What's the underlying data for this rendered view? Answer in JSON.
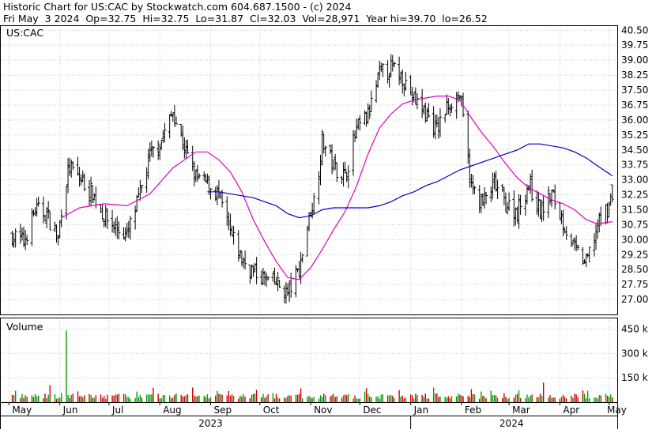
{
  "header": {
    "line1": "Historic Chart for US:CAC by Stockwatch.com 604.687.1500 - (c) 2024",
    "line2": "Fri May  3 2024  Op=32.75  Hi=32.75  Lo=31.87  Cl=32.03  Vol=28,971  Year hi=39.70  lo=26.52"
  },
  "colors": {
    "up_bar": "#00a000",
    "down_bar": "#d40000",
    "ohlc": "#000000",
    "short_ma": "#e000c0",
    "long_ma": "#0000c0",
    "grid": "#c8c8c8"
  },
  "chart_data": [
    {
      "type": "line",
      "subtype": "ohlc-price",
      "title": "US:CAC",
      "x_type": "date",
      "x_range": [
        "2023-05-03",
        "2024-05-03"
      ],
      "ylim": [
        26.25,
        40.75
      ],
      "grid": true,
      "y_ticks": [
        "40.50",
        "39.75",
        "39.00",
        "38.25",
        "37.50",
        "36.75",
        "36.00",
        "35.25",
        "34.50",
        "33.75",
        "33.00",
        "32.25",
        "31.50",
        "30.75",
        "30.00",
        "29.25",
        "28.50",
        "27.75",
        "27.00"
      ],
      "x_ticks": [
        "May",
        "Jun",
        "Jul",
        "Aug",
        "Sep",
        "Oct",
        "Nov",
        "Dec",
        "Jan",
        "Feb",
        "Mar",
        "Apr",
        "May"
      ],
      "x_tick_dates": [
        "2023-05-01",
        "2023-06-01",
        "2023-07-01",
        "2023-08-01",
        "2023-09-01",
        "2023-10-01",
        "2023-11-01",
        "2023-12-01",
        "2024-01-01",
        "2024-02-01",
        "2024-03-01",
        "2024-04-01",
        "2024-05-01"
      ],
      "years": [
        {
          "label": "2023",
          "from": "2023-05-03",
          "to": "2023-12-31"
        },
        {
          "label": "2024",
          "from": "2024-01-01",
          "to": "2024-05-03"
        }
      ],
      "close_path": [
        [
          "2023-05-03",
          30.2
        ],
        [
          "2023-05-10",
          29.9
        ],
        [
          "2023-05-17",
          31.5
        ],
        [
          "2023-05-24",
          31.3
        ],
        [
          "2023-05-31",
          30.0
        ],
        [
          "2023-06-03",
          32.4
        ],
        [
          "2023-06-07",
          33.6
        ],
        [
          "2023-06-14",
          33.0
        ],
        [
          "2023-06-21",
          32.3
        ],
        [
          "2023-06-28",
          31.2
        ],
        [
          "2023-07-05",
          30.6
        ],
        [
          "2023-07-12",
          30.2
        ],
        [
          "2023-07-19",
          32.0
        ],
        [
          "2023-07-26",
          34.2
        ],
        [
          "2023-08-02",
          35.0
        ],
        [
          "2023-08-09",
          36.4
        ],
        [
          "2023-08-16",
          34.6
        ],
        [
          "2023-08-23",
          33.1
        ],
        [
          "2023-08-30",
          32.8
        ],
        [
          "2023-09-06",
          32.2
        ],
        [
          "2023-09-13",
          30.3
        ],
        [
          "2023-09-20",
          29.0
        ],
        [
          "2023-09-27",
          28.4
        ],
        [
          "2023-10-04",
          28.0
        ],
        [
          "2023-10-11",
          27.8
        ],
        [
          "2023-10-18",
          27.3
        ],
        [
          "2023-10-25",
          28.5
        ],
        [
          "2023-11-01",
          31.5
        ],
        [
          "2023-11-04",
          32.2
        ],
        [
          "2023-11-08",
          35.0
        ],
        [
          "2023-11-15",
          33.7
        ],
        [
          "2023-11-22",
          33.2
        ],
        [
          "2023-11-29",
          35.5
        ],
        [
          "2023-12-06",
          36.2
        ],
        [
          "2023-12-13",
          38.3
        ],
        [
          "2023-12-20",
          38.6
        ],
        [
          "2023-12-27",
          38.2
        ],
        [
          "2024-01-03",
          37.0
        ],
        [
          "2024-01-10",
          36.4
        ],
        [
          "2024-01-17",
          35.5
        ],
        [
          "2024-01-24",
          36.8
        ],
        [
          "2024-01-31",
          37.3
        ],
        [
          "2024-02-07",
          32.6
        ],
        [
          "2024-02-14",
          31.8
        ],
        [
          "2024-02-21",
          32.8
        ],
        [
          "2024-02-28",
          31.8
        ],
        [
          "2024-03-06",
          31.4
        ],
        [
          "2024-03-13",
          32.8
        ],
        [
          "2024-03-20",
          31.4
        ],
        [
          "2024-03-27",
          32.3
        ],
        [
          "2024-04-03",
          30.9
        ],
        [
          "2024-04-10",
          29.5
        ],
        [
          "2024-04-17",
          28.8
        ],
        [
          "2024-04-24",
          30.7
        ],
        [
          "2024-05-03",
          32.03
        ]
      ],
      "series": [
        {
          "name": "Short moving average",
          "color": "#e000c0",
          "points": [
            [
              "2023-06-02",
              31.1
            ],
            [
              "2023-06-13",
              31.6
            ],
            [
              "2023-06-28",
              31.8
            ],
            [
              "2023-07-12",
              31.7
            ],
            [
              "2023-07-26",
              32.3
            ],
            [
              "2023-08-09",
              33.6
            ],
            [
              "2023-08-23",
              34.4
            ],
            [
              "2023-08-30",
              34.4
            ],
            [
              "2023-09-06",
              34.0
            ],
            [
              "2023-09-13",
              33.4
            ],
            [
              "2023-09-20",
              32.4
            ],
            [
              "2023-09-27",
              31.0
            ],
            [
              "2023-10-04",
              29.9
            ],
            [
              "2023-10-11",
              28.9
            ],
            [
              "2023-10-18",
              28.1
            ],
            [
              "2023-10-25",
              28.0
            ],
            [
              "2023-11-01",
              28.6
            ],
            [
              "2023-11-08",
              29.5
            ],
            [
              "2023-11-15",
              30.5
            ],
            [
              "2023-11-22",
              31.4
            ],
            [
              "2023-11-29",
              32.7
            ],
            [
              "2023-12-06",
              34.3
            ],
            [
              "2023-12-13",
              35.6
            ],
            [
              "2023-12-20",
              36.3
            ],
            [
              "2023-12-27",
              36.8
            ],
            [
              "2024-01-03",
              37.0
            ],
            [
              "2024-01-10",
              37.1
            ],
            [
              "2024-01-17",
              37.2
            ],
            [
              "2024-01-24",
              37.2
            ],
            [
              "2024-01-31",
              37.0
            ],
            [
              "2024-02-07",
              36.1
            ],
            [
              "2024-02-14",
              35.3
            ],
            [
              "2024-02-21",
              34.6
            ],
            [
              "2024-02-28",
              33.8
            ],
            [
              "2024-03-06",
              33.1
            ],
            [
              "2024-03-13",
              32.6
            ],
            [
              "2024-03-20",
              32.3
            ],
            [
              "2024-03-27",
              32.0
            ],
            [
              "2024-04-03",
              31.8
            ],
            [
              "2024-04-10",
              31.5
            ],
            [
              "2024-04-17",
              31.0
            ],
            [
              "2024-04-24",
              30.8
            ],
            [
              "2024-05-03",
              30.9
            ]
          ]
        },
        {
          "name": "Long moving average",
          "color": "#0000c0",
          "points": [
            [
              "2023-08-30",
              32.4
            ],
            [
              "2023-09-06",
              32.4
            ],
            [
              "2023-09-13",
              32.3
            ],
            [
              "2023-09-20",
              32.2
            ],
            [
              "2023-09-27",
              32.1
            ],
            [
              "2023-10-04",
              31.9
            ],
            [
              "2023-10-11",
              31.7
            ],
            [
              "2023-10-18",
              31.3
            ],
            [
              "2023-10-25",
              31.1
            ],
            [
              "2023-11-01",
              31.2
            ],
            [
              "2023-11-08",
              31.5
            ],
            [
              "2023-11-15",
              31.6
            ],
            [
              "2023-11-22",
              31.6
            ],
            [
              "2023-11-29",
              31.6
            ],
            [
              "2023-12-06",
              31.6
            ],
            [
              "2023-12-13",
              31.7
            ],
            [
              "2023-12-20",
              31.9
            ],
            [
              "2023-12-27",
              32.2
            ],
            [
              "2024-01-03",
              32.4
            ],
            [
              "2024-01-10",
              32.7
            ],
            [
              "2024-01-17",
              32.9
            ],
            [
              "2024-01-24",
              33.2
            ],
            [
              "2024-01-31",
              33.5
            ],
            [
              "2024-02-07",
              33.7
            ],
            [
              "2024-02-14",
              33.9
            ],
            [
              "2024-02-21",
              34.1
            ],
            [
              "2024-02-28",
              34.3
            ],
            [
              "2024-03-06",
              34.5
            ],
            [
              "2024-03-13",
              34.8
            ],
            [
              "2024-03-20",
              34.8
            ],
            [
              "2024-03-27",
              34.7
            ],
            [
              "2024-04-03",
              34.6
            ],
            [
              "2024-04-10",
              34.4
            ],
            [
              "2024-04-17",
              34.1
            ],
            [
              "2024-04-24",
              33.7
            ],
            [
              "2024-05-03",
              33.2
            ]
          ]
        }
      ],
      "last_bar": {
        "date": "2024-05-03",
        "open": 32.75,
        "high": 32.75,
        "low": 31.87,
        "close": 32.03
      }
    },
    {
      "type": "bar",
      "subtype": "volume",
      "title": "Volume",
      "x_type": "date",
      "ylim": [
        0,
        520000
      ],
      "grid": true,
      "y_ticks": [
        {
          "value": 450000,
          "label": "450 k"
        },
        {
          "value": 300000,
          "label": "300 k"
        },
        {
          "value": 150000,
          "label": "150 k"
        }
      ],
      "typical_volume": [
        20000,
        75000
      ],
      "spikes": [
        {
          "date": "2023-06-05",
          "value": 440000,
          "direction": "up"
        },
        {
          "date": "2023-05-26",
          "value": 105000,
          "direction": "down"
        },
        {
          "date": "2023-08-21",
          "value": 90000,
          "direction": "down"
        },
        {
          "date": "2023-10-26",
          "value": 85000,
          "direction": "down"
        },
        {
          "date": "2024-01-15",
          "value": 90000,
          "direction": "up"
        },
        {
          "date": "2024-02-07",
          "value": 80000,
          "direction": "down"
        },
        {
          "date": "2024-03-22",
          "value": 120000,
          "direction": "down"
        },
        {
          "date": "2024-04-18",
          "value": 70000,
          "direction": "up"
        }
      ]
    }
  ]
}
